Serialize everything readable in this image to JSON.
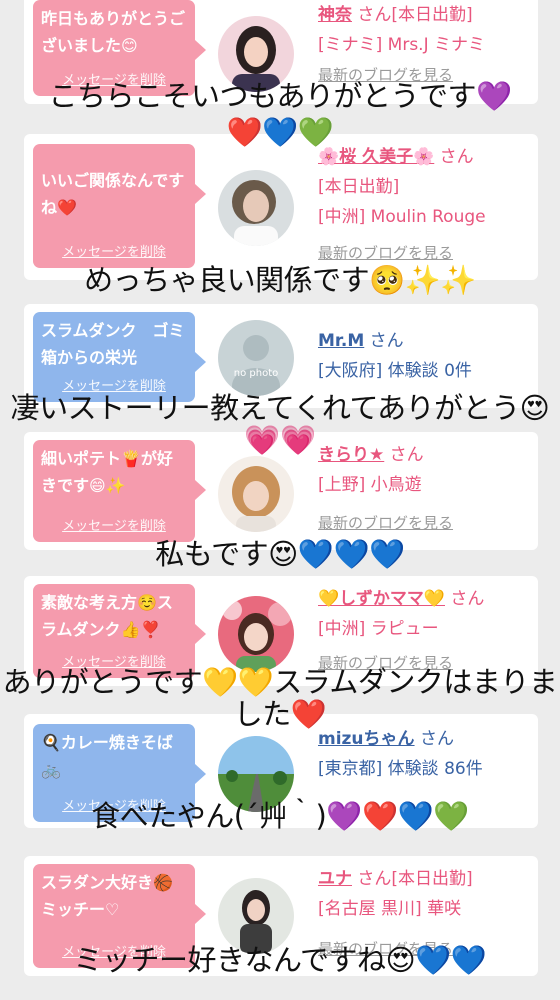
{
  "cards": [
    {
      "bubble_color": "pink",
      "bubble_text": "昨日もありがとうございました😊",
      "delete_label": "メッセージを削除",
      "name": "神奈",
      "name_color": "pink",
      "suffix": "さん[本日出勤]",
      "line2": "[ミナミ] Mrs.J ミナミ",
      "line3": "",
      "blog_label": "最新のブログを見る",
      "avatar_icon": "woman-portrait-icon"
    },
    {
      "bubble_color": "pink",
      "bubble_text": "いいご関係なんですね❤️",
      "delete_label": "メッセージを削除",
      "name": "🌸桜 久美子🌸",
      "name_color": "pink",
      "suffix": "さん",
      "line2": "[本日出勤]",
      "line3": "[中洲] Moulin Rouge",
      "blog_label": "最新のブログを見る",
      "avatar_icon": "woman-portrait-icon"
    },
    {
      "bubble_color": "blue",
      "bubble_text": "スラムダンク　ゴミ箱からの栄光",
      "delete_label": "メッセージを削除",
      "name": "Mr.M",
      "name_color": "blue",
      "suffix": "さん",
      "line2": "[大阪府] 体験談 0件",
      "line3": "",
      "blog_label": "",
      "avatar_icon": "no-photo-icon",
      "avatar_text": "no photo"
    },
    {
      "bubble_color": "pink",
      "bubble_text": "細いポテト🍟が好きです😄✨",
      "delete_label": "メッセージを削除",
      "name": "きらり★",
      "name_color": "pink",
      "suffix": "さん",
      "line2": "[上野] 小鳥遊",
      "line3": "",
      "blog_label": "最新のブログを見る",
      "avatar_icon": "woman-portrait-icon"
    },
    {
      "bubble_color": "pink",
      "bubble_text": "素敵な考え方☺️スラムダンク👍❣️",
      "delete_label": "メッセージを削除",
      "name": "💛しずかママ💛",
      "name_color": "pink",
      "suffix": "さん",
      "line2": "[中洲] ラピュー",
      "line3": "",
      "blog_label": "最新のブログを見る",
      "avatar_icon": "woman-portrait-icon"
    },
    {
      "bubble_color": "blue",
      "bubble_text": "🍳カレー焼きそば🚲",
      "delete_label": "メッセージを削除",
      "name": "mizuちゃん",
      "name_color": "blue",
      "suffix": "さん",
      "line2": "[東京都] 体験談 86件",
      "line3": "",
      "blog_label": "",
      "avatar_icon": "landscape-road-icon"
    },
    {
      "bubble_color": "pink",
      "bubble_text": "スラダン大好き🏀ミッチー♡",
      "delete_label": "メッセージを削除",
      "name": "ユナ",
      "name_color": "pink",
      "suffix": "さん[本日出勤]",
      "line2": "[名古屋 黒川] 華咲",
      "line3": "",
      "blog_label": "最新のブログを見る",
      "avatar_icon": "woman-portrait-icon"
    }
  ],
  "overlays": [
    "こちらこそいつもありがとうです💜",
    "❤️💙💚",
    "めっちゃ良い関係です🥺✨✨",
    "凄いストーリー教えてくれてありがとう😍",
    "💗💗",
    "私もです😍💙💙💙",
    "ありがとうです💛💛スラムダンクはまりま",
    "した❤️",
    "食べたやん(´艸｀)💜❤️💙💚",
    "ミッチー好きなんですね😍💙💙"
  ],
  "colors": {
    "background": "#ececec",
    "bubble_pink": "#f59bad",
    "bubble_blue": "#8fb6ec",
    "name_pink": "#e8567e",
    "name_blue": "#3a63a4"
  }
}
